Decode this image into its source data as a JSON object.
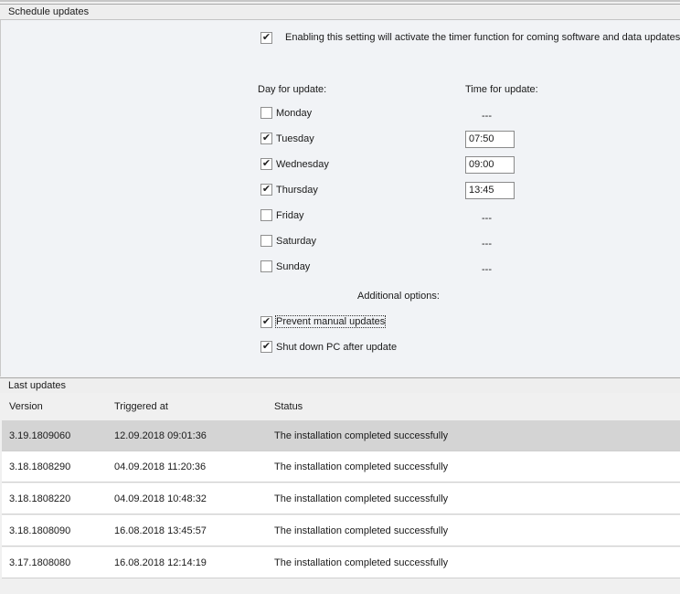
{
  "schedule": {
    "header": "Schedule updates",
    "enable_checked": true,
    "enable_label": "Enabling this setting will activate the timer function for coming software and data updates.",
    "day_header": "Day for update:",
    "time_header": "Time for update:",
    "days": [
      {
        "label": "Monday",
        "checked": false,
        "time": "---"
      },
      {
        "label": "Tuesday",
        "checked": true,
        "time": "07:50"
      },
      {
        "label": "Wednesday",
        "checked": true,
        "time": "09:00"
      },
      {
        "label": "Thursday",
        "checked": true,
        "time": "13:45"
      },
      {
        "label": "Friday",
        "checked": false,
        "time": "---"
      },
      {
        "label": "Saturday",
        "checked": false,
        "time": "---"
      },
      {
        "label": "Sunday",
        "checked": false,
        "time": "---"
      }
    ],
    "additional_label": "Additional options:",
    "options": [
      {
        "label": "Prevent manual updates",
        "checked": true
      },
      {
        "label": "Shut down PC after update",
        "checked": true
      }
    ]
  },
  "last_updates": {
    "header": "Last updates",
    "columns": [
      "Version",
      "Triggered at",
      "Status"
    ],
    "rows": [
      {
        "version": "3.19.1809060",
        "triggered": "12.09.2018 09:01:36",
        "status": "The installation completed successfully"
      },
      {
        "version": "3.18.1808290",
        "triggered": "04.09.2018 11:20:36",
        "status": "The installation completed successfully"
      },
      {
        "version": "3.18.1808220",
        "triggered": "04.09.2018 10:48:32",
        "status": "The installation completed successfully"
      },
      {
        "version": "3.18.1808090",
        "triggered": "16.08.2018 13:45:57",
        "status": "The installation completed successfully"
      },
      {
        "version": "3.17.1808080",
        "triggered": "16.08.2018 12:14:19",
        "status": "The installation completed successfully"
      }
    ]
  },
  "check_glyph": "✔"
}
